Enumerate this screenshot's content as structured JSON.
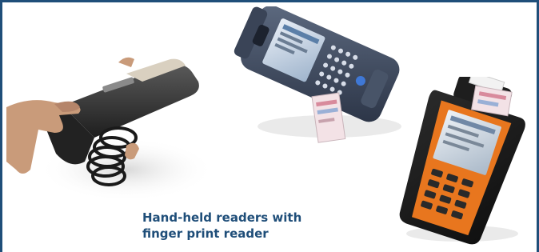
{
  "caption": {
    "line1": "Hand-held readers with",
    "line2": "finger print reader"
  },
  "colors": {
    "border": "#1f4e79",
    "caption_text": "#1f4e79"
  }
}
